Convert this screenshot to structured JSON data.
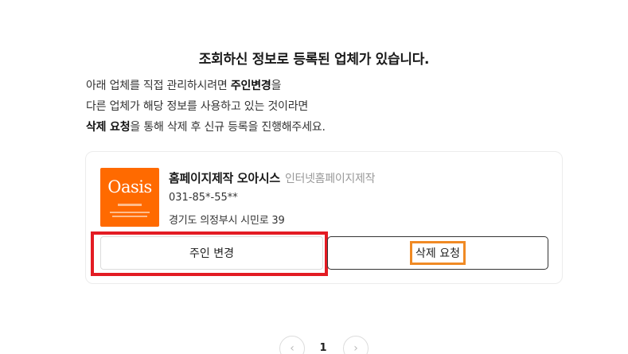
{
  "title": "조회하신 정보로 등록된 업체가 있습니다.",
  "description": {
    "line1_prefix": "아래 업체를 직접 관리하시려면 ",
    "line1_bold": "주인변경",
    "line1_suffix": "을",
    "line2": "다른 업체가 해당 정보를 사용하고 있는 것이라면",
    "line3_bold": "삭제 요청",
    "line3_suffix": "을 통해 삭제 후 신규 등록을 진행해주세요."
  },
  "business": {
    "logo_text": "Oasis",
    "name": "홈페이지제작 오아시스",
    "category": "인터넷홈페이지제작",
    "phone": "031-85*-55**",
    "address": "경기도 의정부시 시민로 39"
  },
  "buttons": {
    "change_owner": "주인 변경",
    "delete_request": "삭제 요청"
  },
  "pagination": {
    "current_page": "1",
    "prev_icon": "chevron-left-icon",
    "next_icon": "chevron-right-icon"
  },
  "colors": {
    "highlight_red": "#e31b23",
    "highlight_orange": "#f08a24",
    "logo_bg": "#ff6a00"
  }
}
